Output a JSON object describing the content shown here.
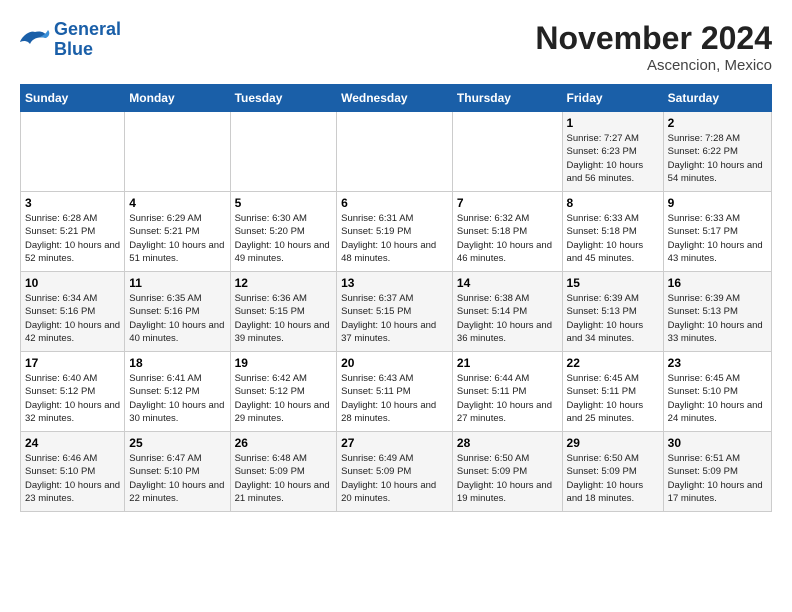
{
  "header": {
    "logo_line1": "General",
    "logo_line2": "Blue",
    "month": "November 2024",
    "location": "Ascencion, Mexico"
  },
  "days_of_week": [
    "Sunday",
    "Monday",
    "Tuesday",
    "Wednesday",
    "Thursday",
    "Friday",
    "Saturday"
  ],
  "weeks": [
    [
      {
        "day": "",
        "info": ""
      },
      {
        "day": "",
        "info": ""
      },
      {
        "day": "",
        "info": ""
      },
      {
        "day": "",
        "info": ""
      },
      {
        "day": "",
        "info": ""
      },
      {
        "day": "1",
        "info": "Sunrise: 7:27 AM\nSunset: 6:23 PM\nDaylight: 10 hours and 56 minutes."
      },
      {
        "day": "2",
        "info": "Sunrise: 7:28 AM\nSunset: 6:22 PM\nDaylight: 10 hours and 54 minutes."
      }
    ],
    [
      {
        "day": "3",
        "info": "Sunrise: 6:28 AM\nSunset: 5:21 PM\nDaylight: 10 hours and 52 minutes."
      },
      {
        "day": "4",
        "info": "Sunrise: 6:29 AM\nSunset: 5:21 PM\nDaylight: 10 hours and 51 minutes."
      },
      {
        "day": "5",
        "info": "Sunrise: 6:30 AM\nSunset: 5:20 PM\nDaylight: 10 hours and 49 minutes."
      },
      {
        "day": "6",
        "info": "Sunrise: 6:31 AM\nSunset: 5:19 PM\nDaylight: 10 hours and 48 minutes."
      },
      {
        "day": "7",
        "info": "Sunrise: 6:32 AM\nSunset: 5:18 PM\nDaylight: 10 hours and 46 minutes."
      },
      {
        "day": "8",
        "info": "Sunrise: 6:33 AM\nSunset: 5:18 PM\nDaylight: 10 hours and 45 minutes."
      },
      {
        "day": "9",
        "info": "Sunrise: 6:33 AM\nSunset: 5:17 PM\nDaylight: 10 hours and 43 minutes."
      }
    ],
    [
      {
        "day": "10",
        "info": "Sunrise: 6:34 AM\nSunset: 5:16 PM\nDaylight: 10 hours and 42 minutes."
      },
      {
        "day": "11",
        "info": "Sunrise: 6:35 AM\nSunset: 5:16 PM\nDaylight: 10 hours and 40 minutes."
      },
      {
        "day": "12",
        "info": "Sunrise: 6:36 AM\nSunset: 5:15 PM\nDaylight: 10 hours and 39 minutes."
      },
      {
        "day": "13",
        "info": "Sunrise: 6:37 AM\nSunset: 5:15 PM\nDaylight: 10 hours and 37 minutes."
      },
      {
        "day": "14",
        "info": "Sunrise: 6:38 AM\nSunset: 5:14 PM\nDaylight: 10 hours and 36 minutes."
      },
      {
        "day": "15",
        "info": "Sunrise: 6:39 AM\nSunset: 5:13 PM\nDaylight: 10 hours and 34 minutes."
      },
      {
        "day": "16",
        "info": "Sunrise: 6:39 AM\nSunset: 5:13 PM\nDaylight: 10 hours and 33 minutes."
      }
    ],
    [
      {
        "day": "17",
        "info": "Sunrise: 6:40 AM\nSunset: 5:12 PM\nDaylight: 10 hours and 32 minutes."
      },
      {
        "day": "18",
        "info": "Sunrise: 6:41 AM\nSunset: 5:12 PM\nDaylight: 10 hours and 30 minutes."
      },
      {
        "day": "19",
        "info": "Sunrise: 6:42 AM\nSunset: 5:12 PM\nDaylight: 10 hours and 29 minutes."
      },
      {
        "day": "20",
        "info": "Sunrise: 6:43 AM\nSunset: 5:11 PM\nDaylight: 10 hours and 28 minutes."
      },
      {
        "day": "21",
        "info": "Sunrise: 6:44 AM\nSunset: 5:11 PM\nDaylight: 10 hours and 27 minutes."
      },
      {
        "day": "22",
        "info": "Sunrise: 6:45 AM\nSunset: 5:11 PM\nDaylight: 10 hours and 25 minutes."
      },
      {
        "day": "23",
        "info": "Sunrise: 6:45 AM\nSunset: 5:10 PM\nDaylight: 10 hours and 24 minutes."
      }
    ],
    [
      {
        "day": "24",
        "info": "Sunrise: 6:46 AM\nSunset: 5:10 PM\nDaylight: 10 hours and 23 minutes."
      },
      {
        "day": "25",
        "info": "Sunrise: 6:47 AM\nSunset: 5:10 PM\nDaylight: 10 hours and 22 minutes."
      },
      {
        "day": "26",
        "info": "Sunrise: 6:48 AM\nSunset: 5:09 PM\nDaylight: 10 hours and 21 minutes."
      },
      {
        "day": "27",
        "info": "Sunrise: 6:49 AM\nSunset: 5:09 PM\nDaylight: 10 hours and 20 minutes."
      },
      {
        "day": "28",
        "info": "Sunrise: 6:50 AM\nSunset: 5:09 PM\nDaylight: 10 hours and 19 minutes."
      },
      {
        "day": "29",
        "info": "Sunrise: 6:50 AM\nSunset: 5:09 PM\nDaylight: 10 hours and 18 minutes."
      },
      {
        "day": "30",
        "info": "Sunrise: 6:51 AM\nSunset: 5:09 PM\nDaylight: 10 hours and 17 minutes."
      }
    ]
  ]
}
